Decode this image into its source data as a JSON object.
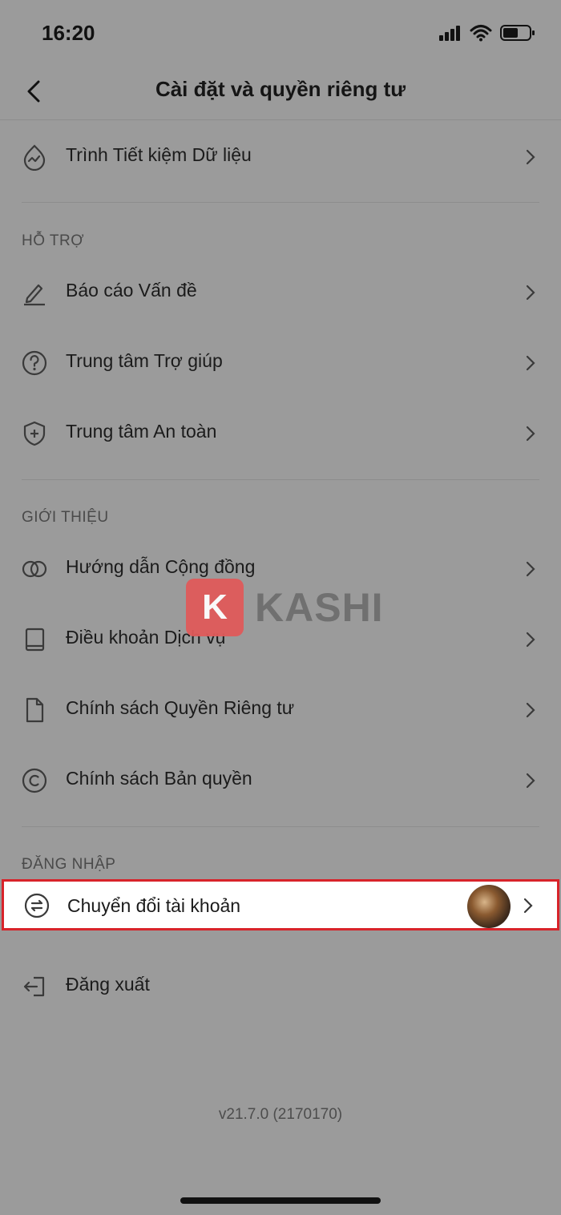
{
  "status": {
    "time": "16:20"
  },
  "header": {
    "title": "Cài đặt và quyền riêng tư"
  },
  "rows_top": [
    {
      "label": "Trình Tiết kiệm Dữ liệu",
      "icon": "data-saver-icon"
    }
  ],
  "sections": {
    "support": {
      "title": "HỖ TRỢ",
      "items": [
        {
          "label": "Báo cáo Vấn đề",
          "icon": "pencil-icon"
        },
        {
          "label": "Trung tâm Trợ giúp",
          "icon": "question-circle-icon"
        },
        {
          "label": "Trung tâm An toàn",
          "icon": "shield-plus-icon"
        }
      ]
    },
    "about": {
      "title": "GIỚI THIỆU",
      "items": [
        {
          "label": "Hướng dẫn Cộng đồng",
          "icon": "rings-icon"
        },
        {
          "label": "Điều khoản Dịch vụ",
          "icon": "book-icon"
        },
        {
          "label": "Chính sách Quyền Riêng tư",
          "icon": "document-icon"
        },
        {
          "label": "Chính sách Bản quyền",
          "icon": "copyright-icon"
        }
      ]
    },
    "login": {
      "title": "ĐĂNG NHẬP",
      "items": [
        {
          "label": "Chuyển đổi tài khoản",
          "icon": "switch-account-icon"
        },
        {
          "label": "Đăng xuất",
          "icon": "logout-icon"
        }
      ]
    }
  },
  "version": "v21.7.0 (2170170)",
  "watermark": {
    "letter": "K",
    "text": "KASHI"
  },
  "colors": {
    "highlight_border": "#d8232a",
    "background": "#9b9b9b"
  }
}
